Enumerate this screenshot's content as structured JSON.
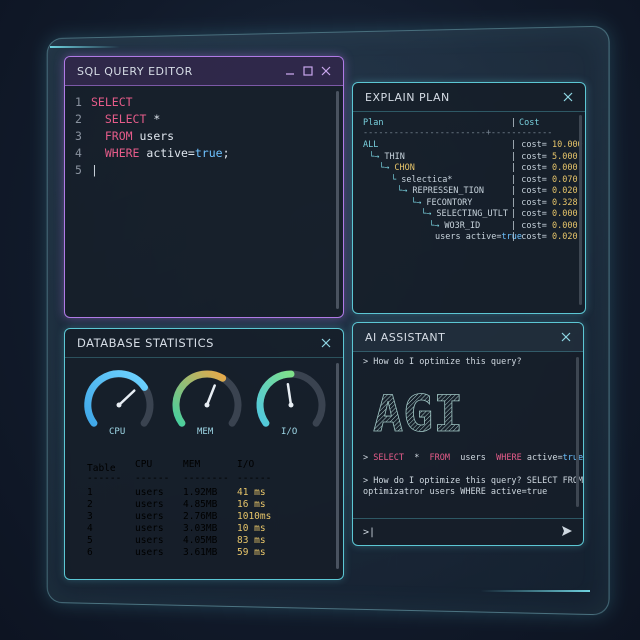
{
  "sql_editor": {
    "title": "SQL QUERY EDITOR",
    "lines": [
      {
        "num": "1",
        "parts": [
          {
            "t": "SELECT",
            "c": "kw"
          }
        ]
      },
      {
        "num": "2",
        "parts": [
          {
            "t": "  SELECT",
            "c": "kw"
          },
          {
            "t": " *",
            "c": ""
          }
        ]
      },
      {
        "num": "3",
        "parts": [
          {
            "t": "  FROM",
            "c": "kw"
          },
          {
            "t": " users",
            "c": ""
          }
        ]
      },
      {
        "num": "4",
        "parts": [
          {
            "t": "  WHERE",
            "c": "kw"
          },
          {
            "t": " active=",
            "c": ""
          },
          {
            "t": "true",
            "c": "bl"
          },
          {
            "t": ";",
            "c": ""
          }
        ]
      },
      {
        "num": "5",
        "parts": []
      }
    ]
  },
  "explain_plan": {
    "title": "EXPLAIN PLAN",
    "col_plan": "Plan",
    "col_cost": "Cost",
    "nodes": [
      "ALL",
      "THIN",
      "CHON",
      "selectica*",
      "REPRESSEN_TION",
      "FECONTORY",
      "SELECTING_UTLT",
      "WO3R_ID",
      "users active=true"
    ],
    "costs": [
      "cost= 10.000",
      "cost= 5.000",
      "cost= 0.000",
      "cost= 0.070",
      "cost= 0.020",
      "cost= 0.328",
      "cost= 0.000",
      "cost= 0.000",
      "cost= 0.020"
    ]
  },
  "stats": {
    "title": "DATABASE STATISTICS",
    "gauges": [
      {
        "label": "CPU",
        "value": 0.72,
        "color_a": "#3fa7e8",
        "color_b": "#6fd3ff"
      },
      {
        "label": "MEM",
        "value": 0.62,
        "color_a": "#44d0a0",
        "color_b": "#e6a94a"
      },
      {
        "label": "I/O",
        "value": 0.5,
        "color_a": "#4fc7e0",
        "color_b": "#7fe08a"
      }
    ],
    "headers": [
      "Table",
      "CPU",
      "MEM",
      "I/O"
    ],
    "rows": [
      [
        "1",
        "users",
        "1.92MB",
        "41 ms"
      ],
      [
        "2",
        "users",
        "4.85MB",
        "16 ms"
      ],
      [
        "3",
        "users",
        "2.76MB",
        "1010ms"
      ],
      [
        "4",
        "users",
        "3.03MB",
        "10 ms"
      ],
      [
        "5",
        "users",
        "4.05MB",
        "83 ms"
      ],
      [
        "6",
        "users",
        "3.61MB",
        "59 ms"
      ]
    ]
  },
  "ai": {
    "title": "AI ASSISTANT",
    "question1": "> How do I optimize this query?",
    "ascii_art": "AGI",
    "query_prompt": ">",
    "query_parts": [
      {
        "t": " SELECT",
        "c": "kw"
      },
      {
        "t": "  * ",
        "c": ""
      },
      {
        "t": " FROM",
        "c": "kw"
      },
      {
        "t": "  users ",
        "c": ""
      },
      {
        "t": " WHERE",
        "c": "kw"
      },
      {
        "t": " active=",
        "c": ""
      },
      {
        "t": "true",
        "c": "bl"
      },
      {
        "t": ";",
        "c": ""
      }
    ],
    "answer_line1": "> How do I optimize this query? SELECT FROM",
    "answer_line2": "  optimizatror users WHERE active=true",
    "input_prompt": ">|",
    "send_icon": "send-icon"
  }
}
